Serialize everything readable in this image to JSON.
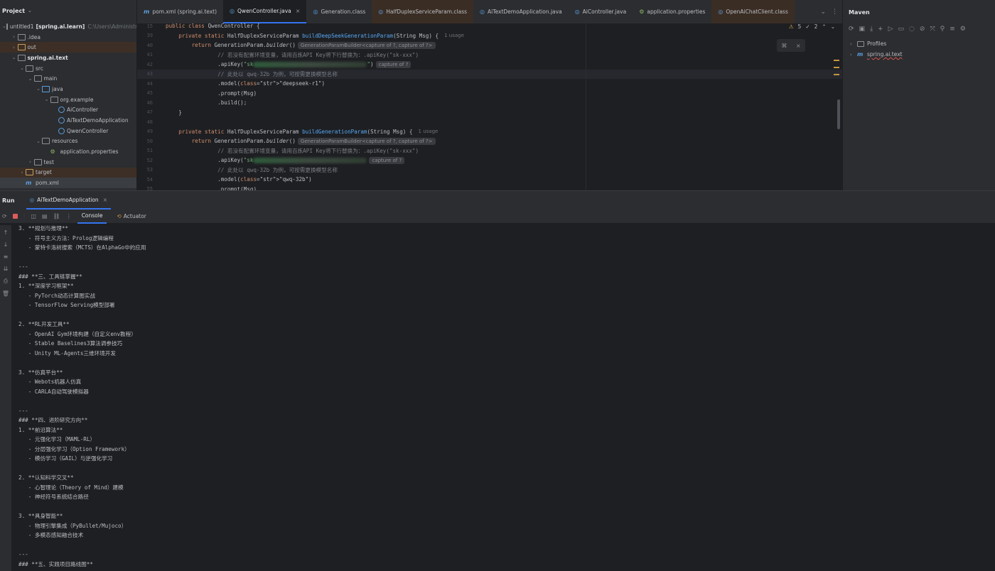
{
  "project": {
    "title": "Project",
    "tree": [
      {
        "label": "untitled1",
        "bold_suffix": "[spring.ai.learn]",
        "path": "C:\\Users\\Administr",
        "depth": 0,
        "arrow": "v",
        "icon": "folder"
      },
      {
        "label": ".idea",
        "depth": 1,
        "arrow": ">",
        "icon": "folder"
      },
      {
        "label": "out",
        "depth": 1,
        "arrow": ">",
        "icon": "folder-orange",
        "highlight": true
      },
      {
        "label": "spring.ai.text",
        "depth": 1,
        "arrow": "v",
        "icon": "folder",
        "bold": true
      },
      {
        "label": "src",
        "depth": 2,
        "arrow": "v",
        "icon": "folder"
      },
      {
        "label": "main",
        "depth": 3,
        "arrow": "v",
        "icon": "folder"
      },
      {
        "label": "java",
        "depth": 4,
        "arrow": "v",
        "icon": "folder-blue"
      },
      {
        "label": "org.example",
        "depth": 5,
        "arrow": "v",
        "icon": "folder"
      },
      {
        "label": "AiController",
        "depth": 6,
        "arrow": "",
        "icon": "class"
      },
      {
        "label": "AiTextDemoApplication",
        "depth": 6,
        "arrow": "",
        "icon": "class"
      },
      {
        "label": "QwenController",
        "depth": 6,
        "arrow": "",
        "icon": "class"
      },
      {
        "label": "resources",
        "depth": 4,
        "arrow": "v",
        "icon": "folder"
      },
      {
        "label": "application.properties",
        "depth": 5,
        "arrow": "",
        "icon": "props"
      },
      {
        "label": "test",
        "depth": 3,
        "arrow": ">",
        "icon": "folder"
      },
      {
        "label": "target",
        "depth": 2,
        "arrow": ">",
        "icon": "folder-orange",
        "highlight": true
      },
      {
        "label": "pom.xml",
        "depth": 2,
        "arrow": "",
        "icon": "maven",
        "selected": true
      }
    ]
  },
  "editor": {
    "tabs": [
      {
        "label": "pom.xml (spring.ai.text)",
        "icon": "m",
        "active": false
      },
      {
        "label": "QwenController.java",
        "icon": "c",
        "active": true,
        "closable": true
      },
      {
        "label": "Generation.class",
        "icon": "c",
        "active": false
      },
      {
        "label": "HalfDuplexServiceParam.class",
        "icon": "c",
        "active": false,
        "warm": true
      },
      {
        "label": "AiTextDemoApplication.java",
        "icon": "c",
        "active": false
      },
      {
        "label": "AiController.java",
        "icon": "c",
        "active": false
      },
      {
        "label": "application.properties",
        "icon": "p",
        "active": false
      },
      {
        "label": "OpenAiChatClient.class",
        "icon": "c",
        "active": false,
        "warm": true
      }
    ],
    "warnings": {
      "warn_count": "5",
      "weak_count": "2"
    },
    "lines": [
      {
        "n": "15",
        "code": "public class QwenController {"
      },
      {
        "n": "39",
        "code": "    private static HalfDuplexServiceParam buildDeepSeekGenerationParam(String Msg) {",
        "usage": "1 usage"
      },
      {
        "n": "40",
        "code": "        return GenerationParam.builder()",
        "hint": "GenerationParamBuilder<capture of ?, capture of ?>"
      },
      {
        "n": "41",
        "code": "                // 若没有配置环境变量，请用百炼API Key将下行替换为：.apiKey(\"sk-xxx\")"
      },
      {
        "n": "42",
        "code": "                .apiKey(\"sk",
        "blurred": true,
        "tail": "\")",
        "hint": "capture of ?"
      },
      {
        "n": "43",
        "code": "                // 此处以 qwq-32b 为例，可按需更换模型名称",
        "current": true
      },
      {
        "n": "44",
        "code": "                .model(\"deepseek-r1\")"
      },
      {
        "n": "45",
        "code": "                .prompt(Msg)"
      },
      {
        "n": "46",
        "code": "                .build();"
      },
      {
        "n": "47",
        "code": "    }"
      },
      {
        "n": "48",
        "code": ""
      },
      {
        "n": "49",
        "code": "    private static HalfDuplexServiceParam buildGenerationParam(String Msg) {",
        "usage": "1 usage"
      },
      {
        "n": "50",
        "code": "        return GenerationParam.builder()",
        "hint": "GenerationParamBuilder<capture of ?, capture of ?>"
      },
      {
        "n": "51",
        "code": "                // 若没有配置环境变量，请用百炼API Key将下行替换为：.apiKey(\"sk-xxx\")"
      },
      {
        "n": "52",
        "code": "                .apiKey(\"sk",
        "blurred": true,
        "tail": "",
        "hint": "capture of ?"
      },
      {
        "n": "53",
        "code": "                // 此处以 qwq-32b 为例，可按需更换模型名称"
      },
      {
        "n": "54",
        "code": "                .model(\"qwq-32b\")"
      },
      {
        "n": "55",
        "code": "                .prompt(Msg)"
      }
    ]
  },
  "maven": {
    "title": "Maven",
    "items": [
      {
        "label": "Profiles",
        "icon": "folder"
      },
      {
        "label": "spring.ai.text",
        "icon": "maven"
      }
    ]
  },
  "run": {
    "title": "Run",
    "config_tab": "AiTextDemoApplication",
    "console_tab": "Console",
    "actuator_tab": "Actuator",
    "lines": [
      "3. **规划与推理**",
      "   - 符号主义方法：Prolog逻辑编程",
      "   - 蒙特卡洛树搜索（MCTS）在AlphaGo中的应用",
      "",
      "---",
      "### **三、工具链掌握**",
      "1. **深度学习框架**",
      "   - PyTorch动态计算图实战",
      "   - TensorFlow Serving模型部署",
      "",
      "2. **RL开发工具**",
      "   - OpenAI Gym环境构建（自定义env教程）",
      "   - Stable Baselines3算法调参技巧",
      "   - Unity ML-Agents三维环境开发",
      "",
      "3. **仿真平台**",
      "   - Webots机器人仿真",
      "   - CARLA自动驾驶模拟器",
      "",
      "---",
      "### **四、进阶研究方向**",
      "1. **前沿算法**",
      "   - 元强化学习（MAML-RL）",
      "   - 分层强化学习（Option Framework）",
      "   - 模仿学习（GAIL）与逆强化学习",
      "",
      "2. **认知科学交叉**",
      "   - 心智理论（Theory of Mind）建模",
      "   - 神经符号系统结合路径",
      "",
      "3. **具身智能**",
      "   - 物理引擎集成（PyBullet/Mujoco）",
      "   - 多模态感知融合技术",
      "",
      "---",
      "### **五、实践项目路线图**"
    ]
  }
}
